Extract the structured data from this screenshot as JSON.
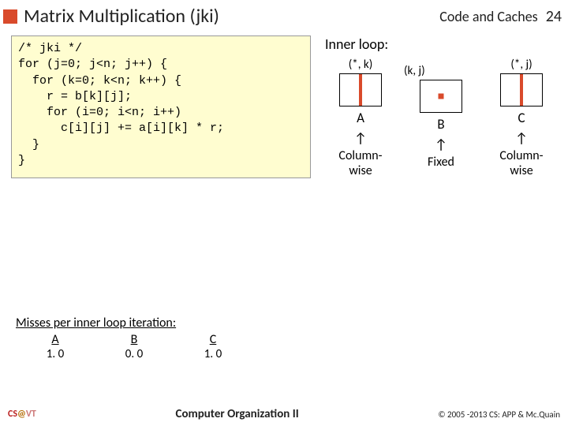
{
  "header": {
    "title": "Matrix Multiplication (jki)",
    "topic": "Code and Caches",
    "page": "24"
  },
  "code": "/* jki */\nfor (j=0; j<n; j++) {\n  for (k=0; k<n; k++) {\n    r = b[k][j];\n    for (i=0; i<n; i++)\n      c[i][j] += a[i][k] * r;\n  }\n}",
  "diagram": {
    "heading": "Inner loop:",
    "A": {
      "idx": "(*, k)",
      "name": "A",
      "access": "Column-\nwise"
    },
    "B": {
      "idx": "(k, j)",
      "name": "B",
      "access": "Fixed"
    },
    "C": {
      "idx": "(*, j)",
      "name": "C",
      "access": "Column-\nwise"
    }
  },
  "misses": {
    "heading": "Misses per inner loop iteration:",
    "cols": {
      "A": "A",
      "B": "B",
      "C": "C"
    },
    "vals": {
      "A": "1. 0",
      "B": "0. 0",
      "C": "1. 0"
    }
  },
  "footer": {
    "cs": "CS",
    "at": "@",
    "vt": "VT",
    "course": "Computer Organization II",
    "copyright": "© 2005 -2013 CS: APP & Mc.Quain"
  }
}
